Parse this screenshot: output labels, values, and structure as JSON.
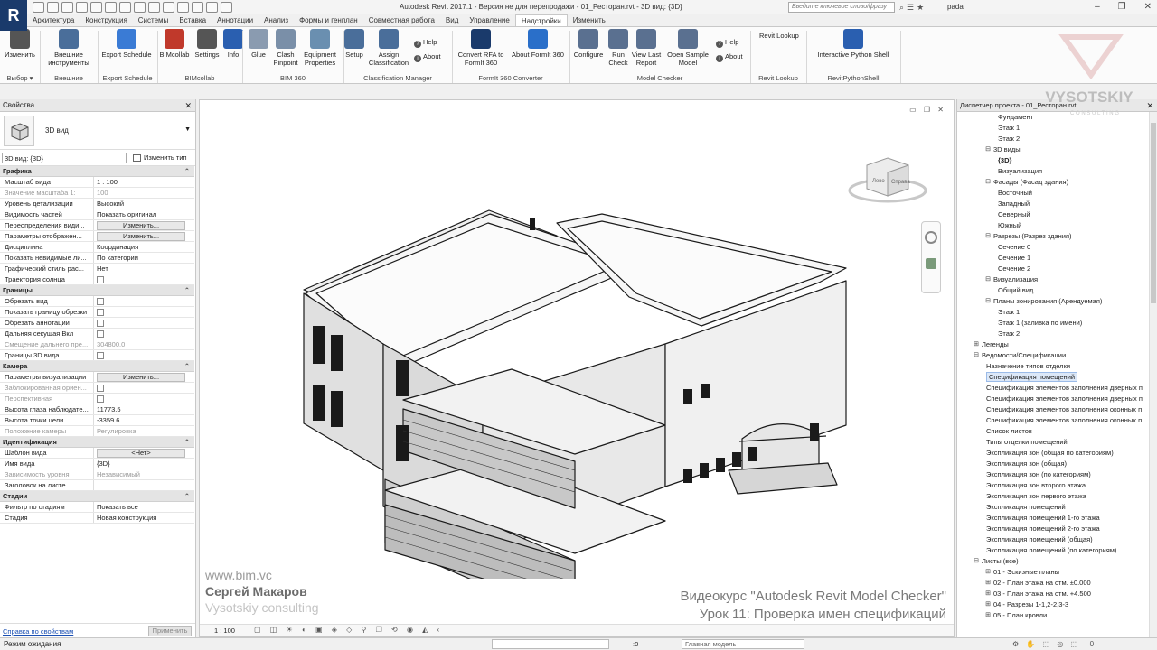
{
  "title_bar": {
    "app_letter": "R",
    "title": "Autodesk Revit 2017.1 - Версия не для перепродажи -   01_Ресторан.rvt - 3D вид: {3D}",
    "search_placeholder": "Введите ключевое слово/фразу",
    "user": "padal"
  },
  "tabs": [
    {
      "label": "Архитектура"
    },
    {
      "label": "Конструкция"
    },
    {
      "label": "Системы"
    },
    {
      "label": "Вставка"
    },
    {
      "label": "Аннотации"
    },
    {
      "label": "Анализ"
    },
    {
      "label": "Формы и генплан"
    },
    {
      "label": "Совместная работа"
    },
    {
      "label": "Вид"
    },
    {
      "label": "Управление"
    },
    {
      "label": "Надстройки",
      "active": true
    },
    {
      "label": "Изменить"
    }
  ],
  "ribbon": {
    "buttons": [
      {
        "label": "Изменить",
        "icon": "cursor-icon",
        "color": "#555555"
      },
      {
        "label": "Внешние инструменты",
        "icon": "tools-icon",
        "color": "#4a6e9a"
      },
      {
        "label": "Export Schedule",
        "icon": "export-icon",
        "color": "#3a7bd5"
      },
      {
        "label": "BIMcollab",
        "icon": "bimcollab-icon",
        "color": "#c0392b"
      },
      {
        "label": "Settings",
        "icon": "gear-icon",
        "color": "#555555"
      },
      {
        "label": "Info",
        "icon": "info-icon",
        "color": "#2a5fb0"
      },
      {
        "label": "Glue",
        "icon": "glue-icon",
        "color": "#8a9bb0"
      },
      {
        "label": "Clash Pinpoint",
        "icon": "clash-icon",
        "color": "#7a8fa8"
      },
      {
        "label": "Equipment Properties",
        "icon": "equipment-icon",
        "color": "#6a8fb0"
      },
      {
        "label": "Setup",
        "icon": "setup-icon",
        "color": "#4a6e9a"
      },
      {
        "label": "Assign Classification",
        "icon": "assign-icon",
        "color": "#4a6e9a"
      },
      {
        "label": "Convert RFA to FormIt 360",
        "icon": "convert-icon",
        "color": "#1a3a6b"
      },
      {
        "label": "About FormIt 360",
        "icon": "formit-icon",
        "color": "#2a6fc9"
      },
      {
        "label": "Configure",
        "icon": "configure-icon",
        "color": "#5a7090"
      },
      {
        "label": "Run Check",
        "icon": "run-icon",
        "color": "#5a7090"
      },
      {
        "label": "View Last Report",
        "icon": "report-icon",
        "color": "#5a7090"
      },
      {
        "label": "Open Sample Model",
        "icon": "open-icon",
        "color": "#5a7090"
      },
      {
        "label": "Interactive Python Shell",
        "icon": "python-icon",
        "color": "#2a5fb0"
      }
    ],
    "small": {
      "help1": "Help",
      "about1": "About",
      "help2": "Help",
      "about2": "About",
      "revit_lookup": "Revit Lookup"
    },
    "groups": [
      "Выбор ▾",
      "Внешние",
      "Export Schedule",
      "BIMcollab",
      "BIM 360",
      "Classification Manager",
      "FormIt 360 Converter",
      "Model Checker",
      "Revit Lookup",
      "RevitPythonShell"
    ]
  },
  "properties": {
    "header": "Свойства",
    "type_name": "3D вид",
    "instance": "3D вид: {3D}",
    "edit_type": "Изменить тип",
    "sections": [
      {
        "name": "Графика",
        "rows": [
          {
            "k": "Масштаб вида",
            "v": "1 : 100"
          },
          {
            "k": "Значение масштаба   1:",
            "v": "100",
            "dis": true
          },
          {
            "k": "Уровень детализации",
            "v": "Высокий"
          },
          {
            "k": "Видимость частей",
            "v": "Показать оригинал"
          },
          {
            "k": "Переопределения види...",
            "v": "Изменить...",
            "btn": true
          },
          {
            "k": "Параметры отображен...",
            "v": "Изменить...",
            "btn": true
          },
          {
            "k": "Дисциплина",
            "v": "Координация"
          },
          {
            "k": "Показать невидимые ли...",
            "v": "По категории"
          },
          {
            "k": "Графический стиль рас...",
            "v": "Нет"
          },
          {
            "k": "Траектория солнца",
            "chk": true
          }
        ]
      },
      {
        "name": "Границы",
        "rows": [
          {
            "k": "Обрезать вид",
            "chk": true
          },
          {
            "k": "Показать границу обрезки",
            "chk": true
          },
          {
            "k": "Обрезать аннотации",
            "chk": true
          },
          {
            "k": "Дальняя секущая Вкл",
            "chk": true
          },
          {
            "k": "Смещение дальнего пре...",
            "v": "304800.0",
            "dis": true
          },
          {
            "k": "Границы 3D вида",
            "chk": true
          }
        ]
      },
      {
        "name": "Камера",
        "rows": [
          {
            "k": "Параметры визуализации",
            "v": "Изменить...",
            "btn": true
          },
          {
            "k": "Заблокированная ориен...",
            "chk": true,
            "dis": true
          },
          {
            "k": "Перспективная",
            "chk": true,
            "dis": true
          },
          {
            "k": "Высота глаза наблюдате...",
            "v": "11773.5"
          },
          {
            "k": "Высота точки цели",
            "v": "-3359.6"
          },
          {
            "k": "Положение камеры",
            "v": "Регулировка",
            "dis": true
          }
        ]
      },
      {
        "name": "Идентификация",
        "rows": [
          {
            "k": "Шаблон вида",
            "v": "<Нет>",
            "btn": true
          },
          {
            "k": "Имя вида",
            "v": "{3D}"
          },
          {
            "k": "Зависимость уровня",
            "v": "Независимый",
            "dis": true
          },
          {
            "k": "Заголовок на листе",
            "v": ""
          }
        ]
      },
      {
        "name": "Стадии",
        "rows": [
          {
            "k": "Фильтр по стадиям",
            "v": "Показать все"
          },
          {
            "k": "Стадия",
            "v": "Новая конструкция"
          }
        ]
      }
    ],
    "help_link": "Справка по свойствам",
    "apply": "Применить"
  },
  "viewcube": {
    "face_left": "Лево",
    "face_right": "Справа"
  },
  "watermark": {
    "line1": "www.bim.vc",
    "line2": "Сергей Макаров",
    "line3": "Vysotskiy consulting"
  },
  "course": {
    "line1": "Видеокурс \"Autodesk Revit Model Checker\"",
    "line2": "Урок 11: Проверка имен спецификаций"
  },
  "view_control": {
    "scale": "1 : 100"
  },
  "logo": {
    "brand": "VYSOTSKIY",
    "sub": "C O N S U L T I N G"
  },
  "browser": {
    "header": "Диспетчер проекта - 01_Ресторан.rvt",
    "nodes": [
      {
        "t": "Фундамент",
        "l": 3
      },
      {
        "t": "Этаж 1",
        "l": 3
      },
      {
        "t": "Этаж 2",
        "l": 3
      },
      {
        "t": "3D виды",
        "l": 2,
        "tg": "−"
      },
      {
        "t": "{3D}",
        "l": 3,
        "b": true
      },
      {
        "t": "Визуализация",
        "l": 3
      },
      {
        "t": "Фасады (Фасад здания)",
        "l": 2,
        "tg": "−"
      },
      {
        "t": "Восточный",
        "l": 3
      },
      {
        "t": "Западный",
        "l": 3
      },
      {
        "t": "Северный",
        "l": 3
      },
      {
        "t": "Южный",
        "l": 3
      },
      {
        "t": "Разрезы (Разрез здания)",
        "l": 2,
        "tg": "−"
      },
      {
        "t": "Сечение 0",
        "l": 3
      },
      {
        "t": "Сечение 1",
        "l": 3
      },
      {
        "t": "Сечение 2",
        "l": 3
      },
      {
        "t": "Визуализация",
        "l": 2,
        "tg": "−"
      },
      {
        "t": "Общий вид",
        "l": 3
      },
      {
        "t": "Планы зонирования (Арендуемая)",
        "l": 2,
        "tg": "−"
      },
      {
        "t": "Этаж 1",
        "l": 3
      },
      {
        "t": "Этаж 1 (заливка по имени)",
        "l": 3
      },
      {
        "t": "Этаж 2",
        "l": 3
      },
      {
        "t": "Легенды",
        "l": 1,
        "tg": "+"
      },
      {
        "t": "Ведомости/Спецификации",
        "l": 1,
        "tg": "−"
      },
      {
        "t": "Назначение типов отделки",
        "l": 2
      },
      {
        "t": "Спецификация помещений",
        "l": 2,
        "sel": true
      },
      {
        "t": "Спецификация элементов заполнения дверных п",
        "l": 2
      },
      {
        "t": "Спецификация элементов заполнения дверных п",
        "l": 2
      },
      {
        "t": "Спецификация элементов заполнения оконных п",
        "l": 2
      },
      {
        "t": "Спецификация элементов заполнения оконных п",
        "l": 2
      },
      {
        "t": "Список листов",
        "l": 2
      },
      {
        "t": "Типы отделки помещений",
        "l": 2
      },
      {
        "t": "Экспликация зон (общая по категориям)",
        "l": 2
      },
      {
        "t": "Экспликация зон (общая)",
        "l": 2
      },
      {
        "t": "Экспликация зон (по категориям)",
        "l": 2
      },
      {
        "t": "Экспликация зон второго этажа",
        "l": 2
      },
      {
        "t": "Экспликация зон первого этажа",
        "l": 2
      },
      {
        "t": "Экспликация помещений",
        "l": 2
      },
      {
        "t": "Экспликация помещений 1-го этажа",
        "l": 2
      },
      {
        "t": "Экспликация помещений 2-го этажа",
        "l": 2
      },
      {
        "t": "Экспликация помещений (общая)",
        "l": 2
      },
      {
        "t": "Экспликация помещений (по категориям)",
        "l": 2
      },
      {
        "t": "Листы (все)",
        "l": 1,
        "tg": "−"
      },
      {
        "t": "01 - Эскизные планы",
        "l": 2,
        "tg": "+"
      },
      {
        "t": "02 - План этажа на отм. ±0.000",
        "l": 2,
        "tg": "+"
      },
      {
        "t": "03 - План этажа на отм. +4.500",
        "l": 2,
        "tg": "+"
      },
      {
        "t": "04 - Разрезы 1-1,2-2,3-3",
        "l": 2,
        "tg": "+"
      },
      {
        "t": "05 - План кровли",
        "l": 2,
        "tg": "+"
      }
    ]
  },
  "status": {
    "text": "Режим ожидания",
    "value": ":0",
    "model": "Главная модель",
    "right_value": ":0"
  }
}
